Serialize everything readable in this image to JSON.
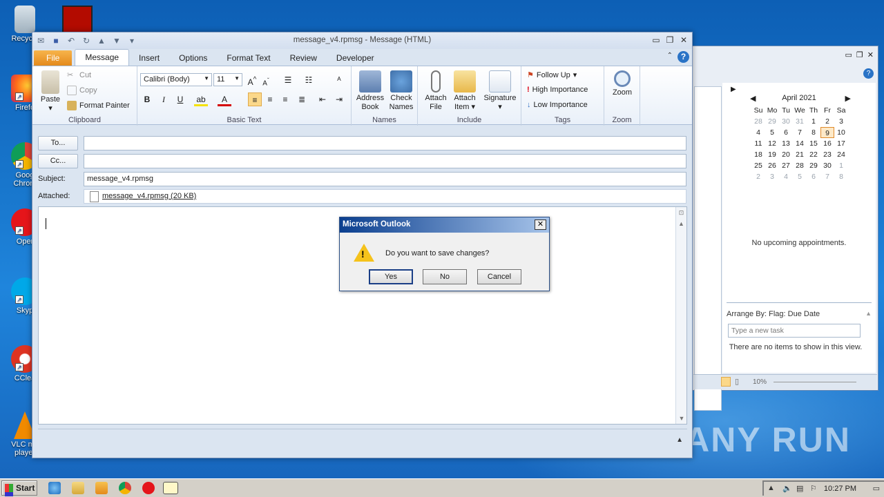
{
  "desktop": {
    "icons": [
      "Recycle",
      "Firefo",
      "Goog Chrom",
      "Oper",
      "Skyp",
      "CClea",
      "VLC me player"
    ],
    "watermark": "ANY RUN"
  },
  "window": {
    "title": "message_v4.rpmsg - Message (HTML)"
  },
  "tabs": [
    "File",
    "Message",
    "Insert",
    "Options",
    "Format Text",
    "Review",
    "Developer"
  ],
  "ribbon": {
    "clipboard": {
      "paste": "Paste",
      "cut": "Cut",
      "copy": "Copy",
      "format_painter": "Format Painter",
      "label": "Clipboard"
    },
    "basic_text": {
      "font": "Calibri (Body)",
      "size": "11",
      "label": "Basic Text"
    },
    "names": {
      "address_book": "Address Book",
      "check_names": "Check Names",
      "label": "Names"
    },
    "include": {
      "attach_file": "Attach File",
      "attach_item": "Attach Item",
      "signature": "Signature",
      "label": "Include"
    },
    "tags": {
      "follow_up": "Follow Up",
      "high": "High Importance",
      "low": "Low Importance",
      "label": "Tags"
    },
    "zoom": {
      "zoom": "Zoom",
      "label": "Zoom"
    }
  },
  "header": {
    "to_label": "To...",
    "cc_label": "Cc...",
    "subject_label": "Subject:",
    "subject_value": "message_v4.rpmsg",
    "attached_label": "Attached:",
    "attachment": "message_v4.rpmsg (20 KB)"
  },
  "dialog": {
    "title": "Microsoft Outlook",
    "message": "Do you want to save changes?",
    "yes": "Yes",
    "no": "No",
    "cancel": "Cancel"
  },
  "todo": {
    "month": "April 2021",
    "weekdays": [
      "Su",
      "Mo",
      "Tu",
      "We",
      "Th",
      "Fr",
      "Sa"
    ],
    "weeks": [
      [
        "28",
        "29",
        "30",
        "31",
        "1",
        "2",
        "3"
      ],
      [
        "4",
        "5",
        "6",
        "7",
        "8",
        "9",
        "10"
      ],
      [
        "11",
        "12",
        "13",
        "14",
        "15",
        "16",
        "17"
      ],
      [
        "18",
        "19",
        "20",
        "21",
        "22",
        "23",
        "24"
      ],
      [
        "25",
        "26",
        "27",
        "28",
        "29",
        "30",
        "1"
      ],
      [
        "2",
        "3",
        "4",
        "5",
        "6",
        "7",
        "8"
      ]
    ],
    "no_appointments": "No upcoming appointments.",
    "arrange_by": "Arrange By: Flag: Due Date",
    "new_task_placeholder": "Type a new task",
    "no_items": "There are no items to show in this view.",
    "zoom_pct": "10%"
  },
  "taskbar": {
    "start": "Start",
    "clock": "10:27 PM"
  }
}
